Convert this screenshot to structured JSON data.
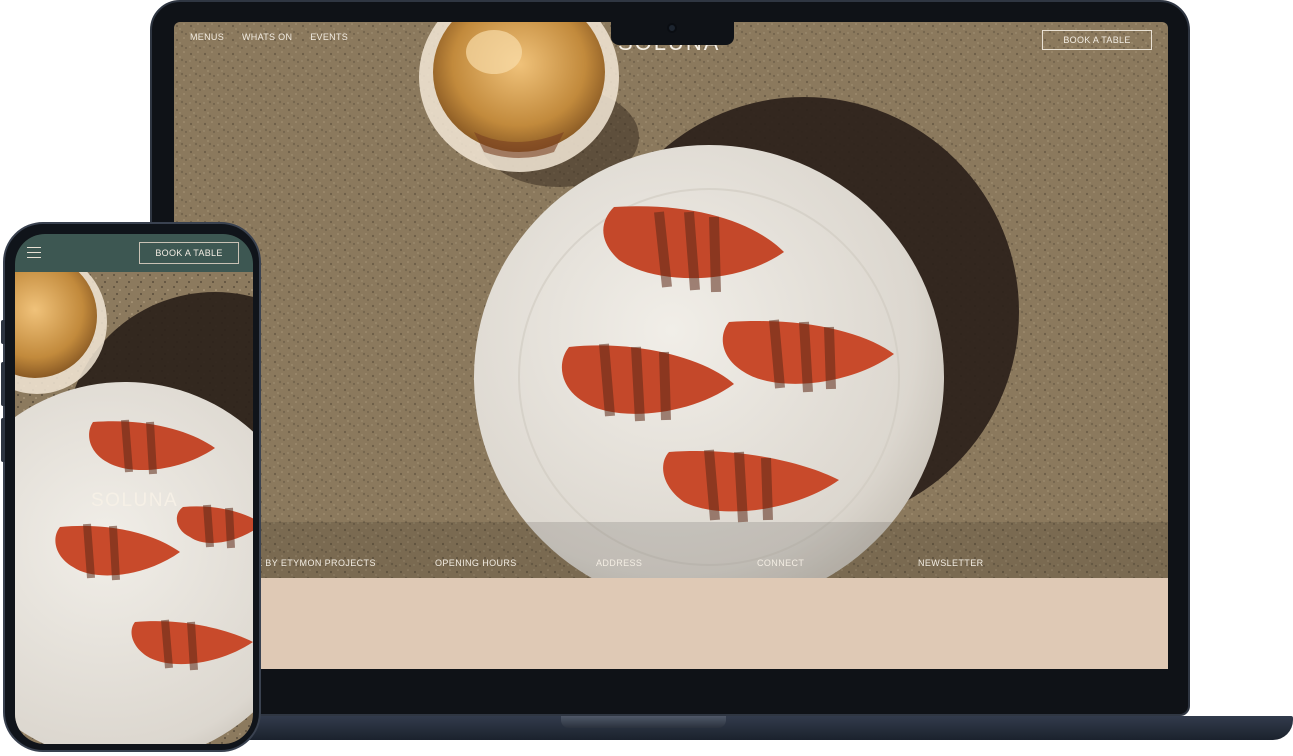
{
  "laptop": {
    "nav": {
      "menus": "MENUS",
      "whats_on": "WHATS ON",
      "events": "EVENTS"
    },
    "logo": "SOLUNA",
    "book_button": "BOOK A TABLE",
    "footer": {
      "credit": "E BY ETYMON PROJECTS",
      "opening_hours": "OPENING HOURS",
      "address": "ADDRESS",
      "connect": "CONNECT",
      "newsletter": "NEWSLETTER"
    }
  },
  "phone": {
    "book_button": "BOOK A TABLE",
    "logo": "SOLUNA",
    "menu_icon": "hamburger-menu-icon"
  },
  "colors": {
    "concrete": "#8c7a5e",
    "plate": "#e7e3dc",
    "fruit": "#c4482a",
    "beige_band": "#dfc9b5",
    "phone_header": "#3d5752",
    "device_frame": "#0f1217"
  }
}
